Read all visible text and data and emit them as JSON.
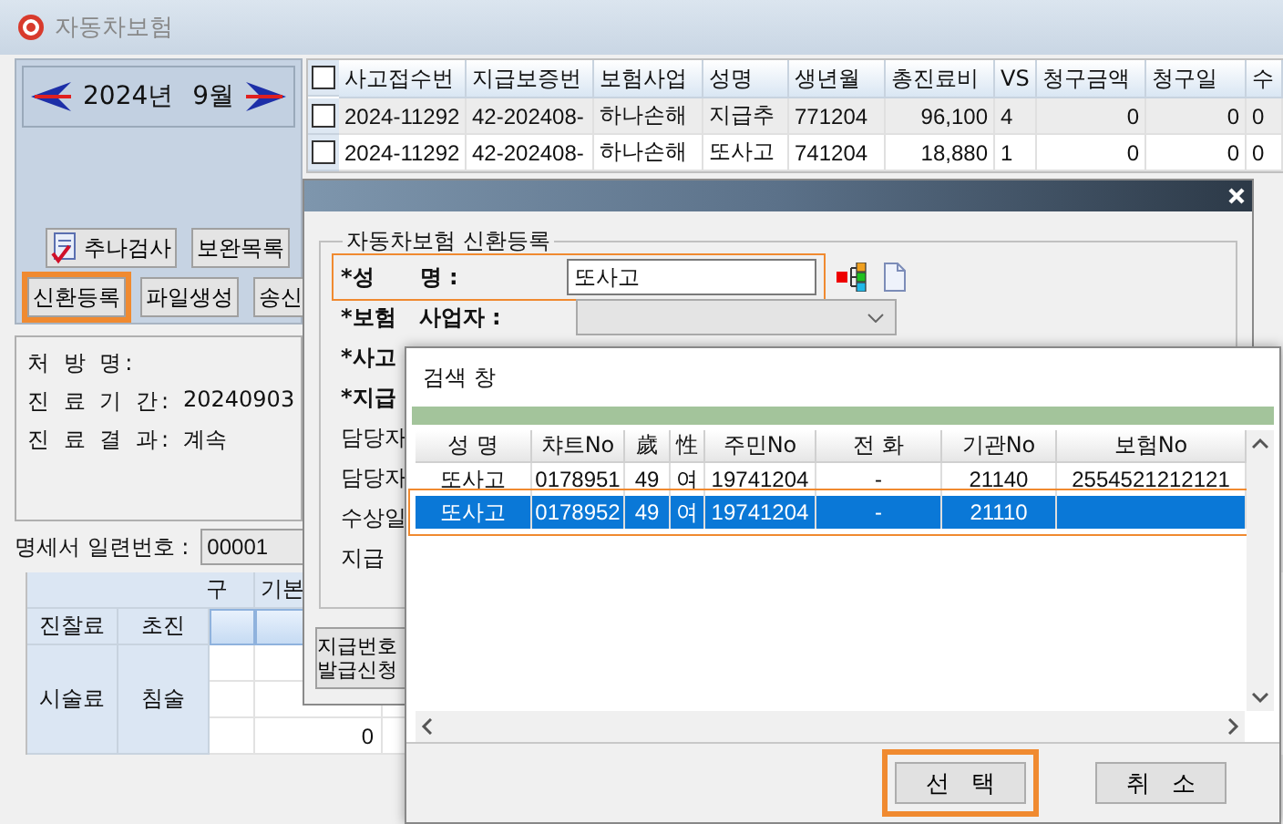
{
  "window": {
    "title": "자동차보험"
  },
  "calendar": {
    "month": "2024년 9월"
  },
  "left_buttons": [
    {
      "label": "추나검사",
      "kind": "icon",
      "highlighted": false
    },
    {
      "label": "보완목록",
      "kind": "plain",
      "highlighted": false
    },
    {
      "label": "신환등록",
      "kind": "plain",
      "highlighted": true
    },
    {
      "label": "파일생성",
      "kind": "plain",
      "highlighted": false
    },
    {
      "label": "송신",
      "kind": "plain",
      "highlighted": false
    }
  ],
  "info": [
    {
      "label": "처 방 명:"
    },
    {
      "label": "진 료 기 간:",
      "value": "20240903"
    },
    {
      "label": "진 료 결 과:",
      "value": "계속"
    }
  ],
  "claims_table": {
    "header_checked": false,
    "columns": [
      "사고접수번",
      "지급보증번",
      "보험사업",
      "성명",
      "생년월",
      "총진료비",
      "VS",
      "청구금액",
      "청구일",
      "수"
    ],
    "rows": [
      {
        "checked": false,
        "cells": [
          "2024-11292",
          "42-202408-",
          "하나손해",
          "지급추",
          "771204",
          "96,100",
          "4",
          "0",
          "0",
          "0"
        ]
      },
      {
        "checked": false,
        "cells": [
          "2024-11292",
          "42-202408-",
          "하나손해",
          "또사고",
          "741204",
          "18,880",
          "1",
          "0",
          "0",
          "0"
        ]
      }
    ]
  },
  "statement": {
    "label": "명세서 일련번호 :",
    "value": "00001"
  },
  "fee_grid": {
    "headers": [
      "구",
      "기본"
    ],
    "rows": [
      {
        "cells": [
          "진찰료",
          "초진"
        ],
        "selected": true
      },
      {
        "cells": [
          "시술료",
          "침술"
        ],
        "selected": false,
        "amount": "0"
      }
    ]
  },
  "dialog": {
    "group_title": "자동차보험 신환등록",
    "fields": [
      {
        "label": "*성      명 :",
        "kind": "text",
        "value": "또사고",
        "highlighted": true
      },
      {
        "label": "*보험   사업자 :",
        "kind": "select",
        "highlighted": false
      },
      {
        "label": "*사고",
        "kind": "hidden",
        "highlighted": false
      },
      {
        "label": "*지급",
        "kind": "hidden",
        "highlighted": false
      },
      {
        "label": "담당자",
        "kind": "hidden",
        "highlighted": false
      },
      {
        "label": "담당자",
        "kind": "hidden",
        "highlighted": false
      },
      {
        "label": "수상일",
        "kind": "hidden",
        "highlighted": false
      },
      {
        "label": "지급",
        "kind": "hidden",
        "highlighted": false
      }
    ],
    "button_lines": [
      "지급번호",
      "발급신청"
    ]
  },
  "search_window": {
    "title": "검색 창",
    "columns": [
      "성 명",
      "챠트No",
      "歲",
      "性",
      "주민No",
      "전 화",
      "기관No",
      "보험No"
    ],
    "rows": [
      {
        "selected": false,
        "highlighted": false,
        "cells": [
          "또사고",
          "0178951",
          "49",
          "여",
          "19741204",
          "-",
          "21140",
          "2554521212121"
        ]
      },
      {
        "selected": true,
        "highlighted": true,
        "cells": [
          "또사고",
          "0178952",
          "49",
          "여",
          "19741204",
          "-",
          "21110"
        ]
      }
    ],
    "buttons": [
      {
        "label": "선   택",
        "highlighted": true
      },
      {
        "label": "취   소",
        "highlighted": false
      }
    ]
  }
}
